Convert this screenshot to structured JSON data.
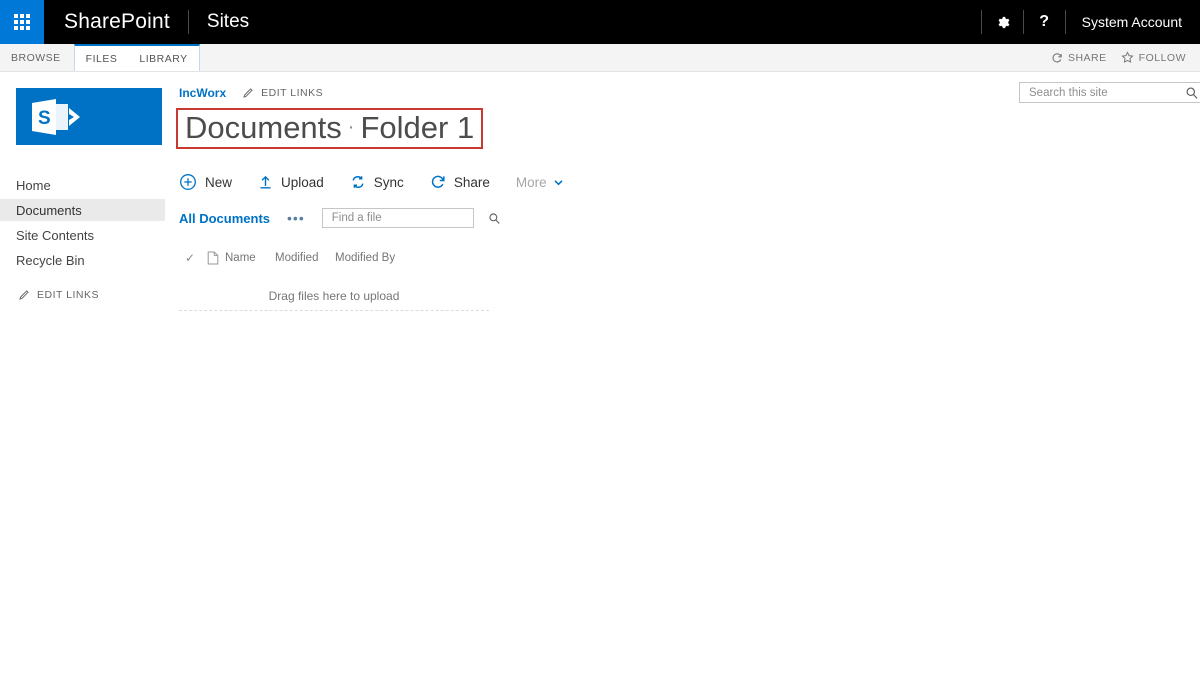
{
  "suite_bar": {
    "waffle_icon": "app-launcher-waffle-icon",
    "brand": "SharePoint",
    "site_label": "Sites",
    "settings_icon": "gear-icon",
    "help_icon": "question-mark-icon",
    "user_name": "System Account"
  },
  "ribbon": {
    "tabs": [
      {
        "label": "BROWSE",
        "selected": false
      },
      {
        "label": "FILES",
        "selected": true
      },
      {
        "label": "LIBRARY",
        "selected": true
      }
    ],
    "share_label": "SHARE",
    "follow_label": "FOLLOW",
    "share_icon": "share-circle-icon",
    "follow_icon": "star-icon",
    "accent_color": "#0072c6"
  },
  "left_nav": {
    "logo_icon": "sharepoint-logo-icon",
    "logo_color": "#0072c6",
    "items": [
      {
        "label": "Home",
        "selected": false
      },
      {
        "label": "Documents",
        "selected": true
      },
      {
        "label": "Site Contents",
        "selected": false
      },
      {
        "label": "Recycle Bin",
        "selected": false
      }
    ],
    "edit_links_label": "EDIT LINKS",
    "edit_links_icon": "pencil-icon"
  },
  "header": {
    "breadcrumb": "IncWorx",
    "edit_links_label": "EDIT LINKS",
    "edit_links_icon": "pencil-icon",
    "title_primary": "Documents",
    "title_separator": "·",
    "title_secondary": "Folder 1",
    "highlight_color": "#c8392f"
  },
  "site_search": {
    "placeholder": "Search this site",
    "value": "",
    "icon": "search-icon"
  },
  "command_bar": {
    "commands": [
      {
        "label": "New",
        "icon": "plus-circle-icon",
        "muted": false
      },
      {
        "label": "Upload",
        "icon": "upload-arrow-icon",
        "muted": false
      },
      {
        "label": "Sync",
        "icon": "sync-arrows-icon",
        "muted": false
      },
      {
        "label": "Share",
        "icon": "share-circle-icon",
        "muted": false
      },
      {
        "label": "More",
        "icon": "chevron-down-icon",
        "muted": true
      }
    ]
  },
  "filter_bar": {
    "view_label": "All Documents",
    "ellipsis": "•••",
    "find_placeholder": "Find a file",
    "find_value": "",
    "find_icon": "search-icon"
  },
  "file_list": {
    "columns": [
      {
        "label": "",
        "icon": "checkmark-icon"
      },
      {
        "label": "",
        "icon": "document-icon"
      },
      {
        "label": "Name"
      },
      {
        "label": "Modified"
      },
      {
        "label": "Modified By"
      }
    ],
    "rows": [],
    "empty_message": "Drag files here to upload"
  }
}
